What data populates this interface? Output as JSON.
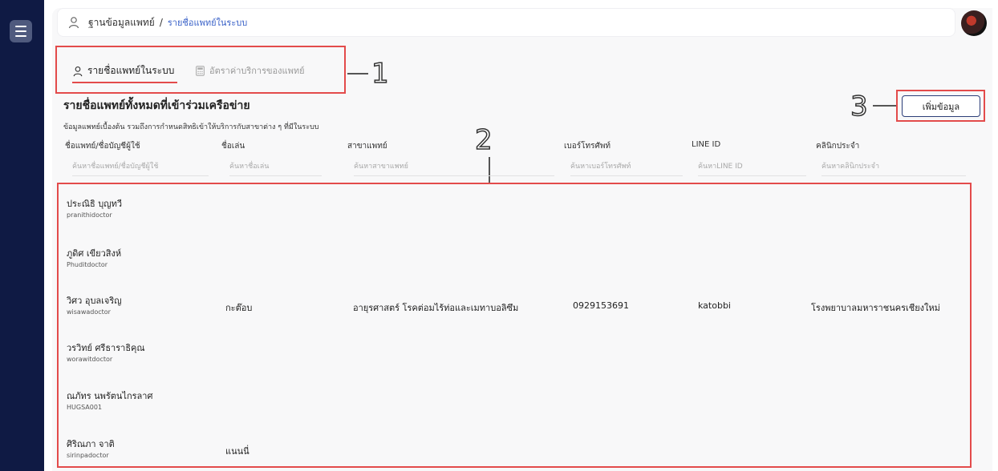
{
  "header": {
    "breadcrumb_root": "ฐานข้อมูลแพทย์",
    "breadcrumb_sep": "/",
    "breadcrumb_current": "รายชื่อแพทย์ในระบบ"
  },
  "tabs": [
    {
      "label": "รายชื่อแพทย์ในระบบ",
      "icon": "doctor-icon",
      "active": true
    },
    {
      "label": "อัตราค่าบริการของแพทย์",
      "icon": "calculator-icon",
      "active": false
    }
  ],
  "section": {
    "title": "รายชื่อแพทย์ทั้งหมดที่เข้าร่วมเครือข่าย",
    "subtitle": "ข้อมูลแพทย์เบื้องต้น รวมถึงการกำหนดสิทธิเข้าให้บริการกับสาขาต่าง ๆ ที่มีในระบบ"
  },
  "add_button": "เพิ่มข้อมูล",
  "callouts": [
    "1",
    "2",
    "3"
  ],
  "columns": [
    {
      "header": "ชื่อแพทย์/ชื่อบัญชีผู้ใช้",
      "placeholder": "ค้นหาชื่อแพทย์/ชื่อบัญชีผู้ใช้"
    },
    {
      "header": "ชื่อเล่น",
      "placeholder": "ค้นหาชื่อเล่น"
    },
    {
      "header": "สาขาแพทย์",
      "placeholder": "ค้นหาสาขาแพทย์"
    },
    {
      "header": "เบอร์โทรศัพท์",
      "placeholder": "ค้นหาเบอร์โทรศัพท์"
    },
    {
      "header": "LINE ID",
      "placeholder": "ค้นหาLINE ID"
    },
    {
      "header": "คลินิกประจำ",
      "placeholder": "ค้นหาคลินิกประจำ"
    }
  ],
  "rows": [
    {
      "name": "ประณิธิ บุญทวี",
      "username": "pranithidoctor",
      "nickname": "",
      "specialty": "",
      "phone": "",
      "line_id": "",
      "clinic": ""
    },
    {
      "name": "ภูดิศ เขียวสิงห์",
      "username": "Phuditdoctor",
      "nickname": "",
      "specialty": "",
      "phone": "",
      "line_id": "",
      "clinic": ""
    },
    {
      "name": "วิศว อุบลเจริญ",
      "username": "wisawadoctor",
      "nickname": "กะต๊อบ",
      "specialty": "อายุรศาสตร์ โรคต่อมไร้ท่อและเมทาบอลิซึม",
      "phone": "0929153691",
      "line_id": "katobbi",
      "clinic": "โรงพยาบาลมหาราชนครเชียงใหม่"
    },
    {
      "name": "วรวิทย์ ศรีธาราธิคุณ",
      "username": "worawitdoctor",
      "nickname": "",
      "specialty": "",
      "phone": "",
      "line_id": "",
      "clinic": ""
    },
    {
      "name": "ณภัทร นพรัตนไกรลาศ",
      "username": "HUGSA001",
      "nickname": "",
      "specialty": "",
      "phone": "",
      "line_id": "",
      "clinic": ""
    },
    {
      "name": "ศิริณภา จาติ",
      "username": "sirinpadoctor",
      "nickname": "แนนนี่",
      "specialty": "",
      "phone": "",
      "line_id": "",
      "clinic": ""
    }
  ],
  "colors": {
    "nav": "#0f1a44",
    "accent": "#3a62c8",
    "callout_border": "#e34b4b"
  }
}
